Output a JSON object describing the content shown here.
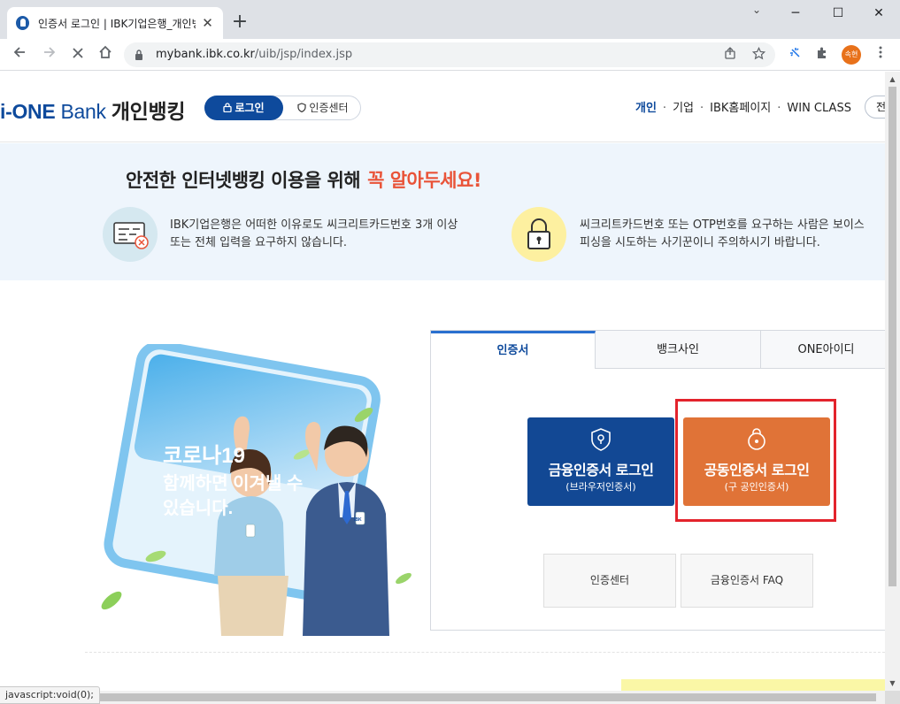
{
  "browser": {
    "tab_title": "인증서 로그인 | IBK기업은행_개인뱅킹",
    "tab_close": "✕",
    "new_tab": "+",
    "window_controls": {
      "tab_search": "⌄",
      "minimize": "─",
      "maximize": "☐",
      "close": "✕"
    },
    "url_host": "mybank.ibk.co.kr",
    "url_path": "/uib/jsp/index.jsp",
    "profile_label": "속현",
    "status_text": "javascript:void(0);"
  },
  "header": {
    "logo_prefix": "i-ONE",
    "logo_bank": "Bank",
    "logo_kr": "개인뱅킹",
    "login_label": "로그인",
    "cert_center_label": "인증센터",
    "nav": [
      "개인",
      "기업",
      "IBK홈페이지",
      "WIN CLASS"
    ],
    "nav_sep": "·",
    "cut_pill": "전"
  },
  "notice": {
    "title": "안전한 인터넷뱅킹 이용을 위해",
    "title_em": "꼭 알아두세요!",
    "item1_line1": "IBK기업은행은 어떠한 이유로도 씨크리트카드번호 3개 이상",
    "item1_line2": "또는 전체 입력을 요구하지 않습니다.",
    "item2_line1": "씨크리트카드번호 또는 OTP번호를 요구하는 사람은 보이스",
    "item2_line2": "피싱을 시도하는 사기꾼이니 주의하시기 바랍니다."
  },
  "promo": {
    "line1": "코로나19",
    "line2": "함께하면 이겨낼 수",
    "line3": "있습니다.",
    "badge": "IBK"
  },
  "login": {
    "tabs": [
      "인증서",
      "뱅크사인",
      "ONE아이디"
    ],
    "fin_title": "금융인증서 로그인",
    "fin_sub": "(브라우저인증서)",
    "joint_title": "공동인증서 로그인",
    "joint_sub": "(구 공인인증서)",
    "cert_center": "인증센터",
    "faq": "금융인증서 FAQ"
  },
  "colors": {
    "brand_blue": "#0e4a9c",
    "fin_button": "#124894",
    "joint_button": "#e07337",
    "highlight_frame": "#e3232c",
    "notice_em": "#e95338"
  }
}
